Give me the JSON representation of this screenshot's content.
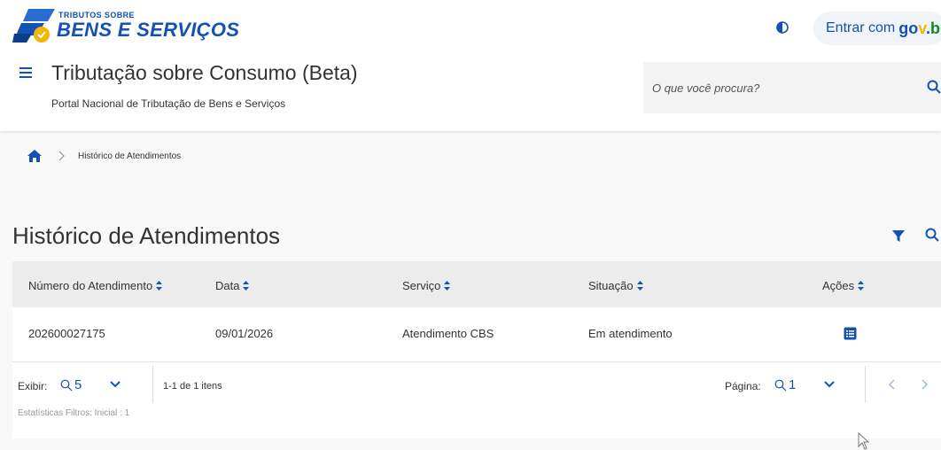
{
  "header": {
    "logo_small": "TRIBUTOS SOBRE",
    "logo_big": "BENS E SERVIÇOS",
    "login_prefix": "Entrar com",
    "login_brand": [
      "go",
      "v",
      ".",
      "br"
    ],
    "site_title": "Tributação sobre Consumo (Beta)",
    "site_subtitle": "Portal Nacional de Tributação de Bens e Serviços",
    "search_placeholder": "O que você procura?"
  },
  "breadcrumb": {
    "current": "Histórico de Atendimentos"
  },
  "page": {
    "title": "Histórico de Atendimentos"
  },
  "table": {
    "columns": [
      "Número do Atendimento",
      "Data",
      "Serviço",
      "Situação",
      "Ações"
    ],
    "rows": [
      [
        "202600027175",
        "09/01/2026",
        "Atendimento CBS",
        "Em atendimento"
      ]
    ]
  },
  "pagination": {
    "show_label": "Exibir:",
    "page_size": "5",
    "items_text": "1-1 de 1 itens",
    "page_label": "Página:",
    "page_number": "1",
    "stats": "Estatísticas Filtros: Inicial : 1"
  },
  "colors": {
    "brand_blue": "#1351b4",
    "govbr_yellow": "#f2b705",
    "govbr_green": "#168821"
  }
}
